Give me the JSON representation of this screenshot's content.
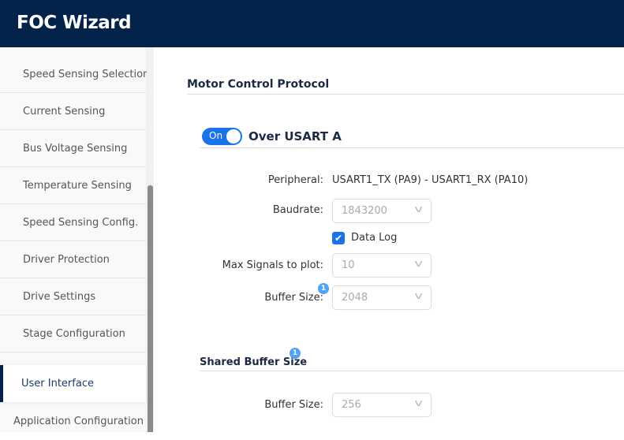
{
  "header": {
    "title": "FOC Wizard"
  },
  "sidebar": {
    "items": [
      {
        "label": "Speed Sensing Selection"
      },
      {
        "label": "Current Sensing"
      },
      {
        "label": "Bus Voltage Sensing"
      },
      {
        "label": "Temperature Sensing"
      },
      {
        "label": "Speed Sensing Config."
      },
      {
        "label": "Driver Protection"
      },
      {
        "label": "Drive Settings"
      },
      {
        "label": "Stage Configuration"
      },
      {
        "label": "User Interface",
        "active": true
      },
      {
        "label": "Application Configuration"
      }
    ]
  },
  "main": {
    "section_title": "Motor Control Protocol",
    "usart": {
      "toggle_label": "On",
      "toggle_on": true,
      "title": "Over USART A",
      "peripheral_label": "Peripheral:",
      "peripheral_value": "USART1_TX (PA9) - USART1_RX (PA10)",
      "baudrate_label": "Baudrate:",
      "baudrate_value": "1843200",
      "datalog_label": "Data Log",
      "datalog_checked": true,
      "max_signals_label": "Max Signals to plot:",
      "max_signals_value": "10",
      "buffer_label": "Buffer Size:",
      "buffer_value": "2048",
      "buffer_badge": "1"
    },
    "shared": {
      "title": "Shared Buffer Size",
      "badge": "1",
      "buffer_label": "Buffer Size:",
      "buffer_value": "256"
    }
  }
}
